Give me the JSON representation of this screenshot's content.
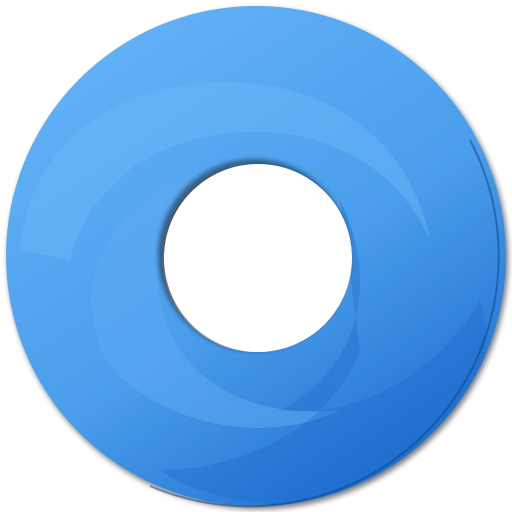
{
  "icon": {
    "name": "blue-ring-swirl-icon",
    "colors": {
      "background": "#ffffff",
      "ring_light": "#63B1F7",
      "ring_mid": "#4A9EEB",
      "ring_dark": "#1E6FD0",
      "swirl_highlight": "#5CAAF2",
      "edge_shadow": "#0F3F78",
      "hole": "#ffffff"
    }
  }
}
